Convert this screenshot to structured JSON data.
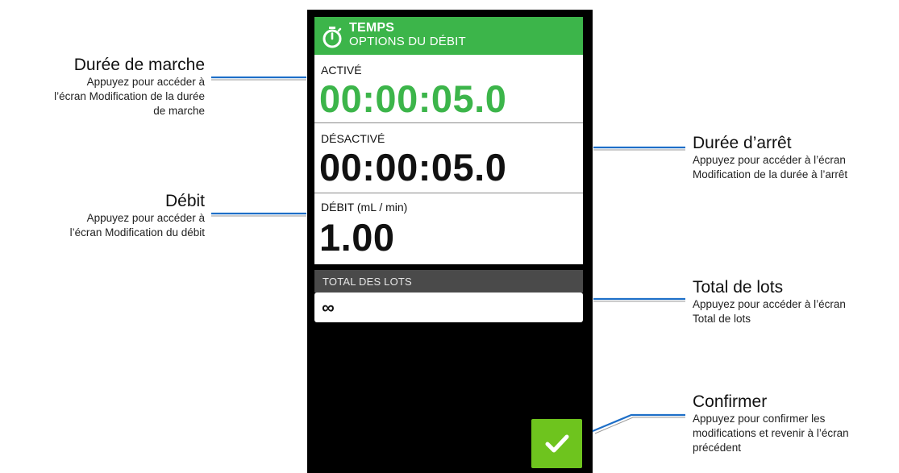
{
  "screen": {
    "header": {
      "title": "TEMPS",
      "subtitle": "OPTIONS DU DÉBIT",
      "icon": "stopwatch-icon",
      "color": "#3cb54a"
    },
    "on_time": {
      "label": "ACTIVÉ",
      "value": "00:00:05.0",
      "color": "#3cb54a"
    },
    "off_time": {
      "label": "DÉSACTIVÉ",
      "value": "00:00:05.0"
    },
    "flow_rate": {
      "label": "DÉBIT (mL / min)",
      "value": "1.00"
    },
    "batch_total": {
      "label": "TOTAL DES LOTS",
      "value": "∞"
    },
    "confirm": {
      "icon": "checkmark-icon",
      "color": "#6ec41e"
    }
  },
  "annotations": {
    "run_time": {
      "title": "Durée de marche",
      "desc": [
        "Appuyez pour accéder à",
        "l’écran Modification de la durée",
        "de marche"
      ]
    },
    "flow": {
      "title": "Débit",
      "desc": [
        "Appuyez pour accéder à",
        "l’écran Modification du débit"
      ]
    },
    "off_time": {
      "title": "Durée d’arrêt",
      "desc": [
        "Appuyez pour accéder à l’écran",
        "Modification de la durée à l’arrêt"
      ]
    },
    "batch_total": {
      "title": "Total de lots",
      "desc": [
        "Appuyez pour accéder à l’écran",
        "Total de lots"
      ]
    },
    "confirm": {
      "title": "Confirmer",
      "desc": [
        "Appuyez pour confirmer les",
        "modifications et revenir à l’écran",
        "précédent"
      ]
    },
    "leader_color": "#1e6fc8"
  }
}
